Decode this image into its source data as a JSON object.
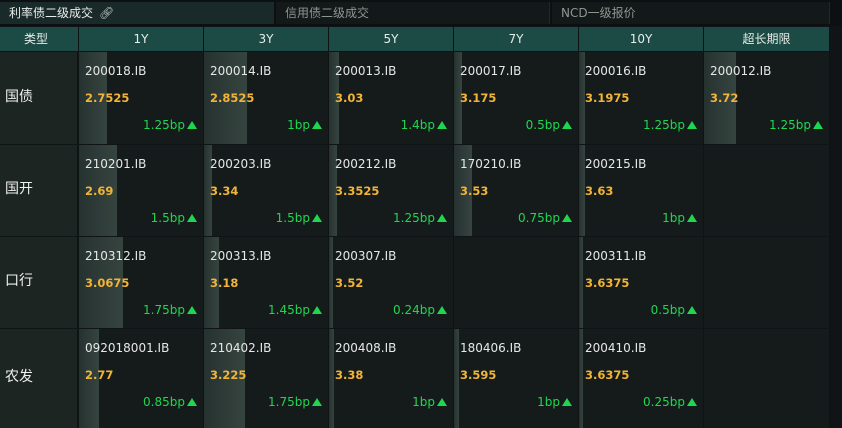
{
  "tabs": [
    {
      "label": "利率债二级成交",
      "active": true
    },
    {
      "label": "信用债二级成交",
      "active": false
    },
    {
      "label": "NCD一级报价",
      "active": false
    }
  ],
  "header": {
    "type_label": "类型",
    "columns": [
      "1Y",
      "3Y",
      "5Y",
      "7Y",
      "10Y",
      "超长期限"
    ]
  },
  "rows": [
    {
      "label": "国债",
      "cells": [
        {
          "code": "200018.IB",
          "price": "2.7525",
          "change": "1.25bp",
          "bar": 0.22
        },
        {
          "code": "200014.IB",
          "price": "2.8525",
          "change": "1bp",
          "bar": 0.34
        },
        {
          "code": "200013.IB",
          "price": "3.03",
          "change": "1.4bp",
          "bar": 0.08
        },
        {
          "code": "200017.IB",
          "price": "3.175",
          "change": "0.5bp",
          "bar": 0.06
        },
        {
          "code": "200016.IB",
          "price": "3.1975",
          "change": "1.25bp",
          "bar": 0.05
        },
        {
          "code": "200012.IB",
          "price": "3.72",
          "change": "1.25bp",
          "bar": 0.25
        }
      ]
    },
    {
      "label": "国开",
      "cells": [
        {
          "code": "210201.IB",
          "price": "2.69",
          "change": "1.5bp",
          "bar": 0.3
        },
        {
          "code": "200203.IB",
          "price": "3.34",
          "change": "1.5bp",
          "bar": 0.06
        },
        {
          "code": "200212.IB",
          "price": "3.3525",
          "change": "1.25bp",
          "bar": 0.06
        },
        {
          "code": "170210.IB",
          "price": "3.53",
          "change": "0.75bp",
          "bar": 0.14
        },
        {
          "code": "200215.IB",
          "price": "3.63",
          "change": "1bp",
          "bar": 0.05
        },
        null
      ]
    },
    {
      "label": "口行",
      "cells": [
        {
          "code": "210312.IB",
          "price": "3.0675",
          "change": "1.75bp",
          "bar": 0.35
        },
        {
          "code": "200313.IB",
          "price": "3.18",
          "change": "1.45bp",
          "bar": 0.12
        },
        {
          "code": "200307.IB",
          "price": "3.52",
          "change": "0.24bp",
          "bar": 0.03
        },
        null,
        {
          "code": "200311.IB",
          "price": "3.6375",
          "change": "0.5bp",
          "bar": 0.03
        },
        null
      ]
    },
    {
      "label": "农发",
      "cells": [
        {
          "code": "092018001.IB",
          "price": "2.77",
          "change": "0.85bp",
          "bar": 0.16
        },
        {
          "code": "210402.IB",
          "price": "3.225",
          "change": "1.75bp",
          "bar": 0.33
        },
        {
          "code": "200408.IB",
          "price": "3.38",
          "change": "1bp",
          "bar": 0.04
        },
        {
          "code": "180406.IB",
          "price": "3.595",
          "change": "1bp",
          "bar": 0.04
        },
        {
          "code": "200410.IB",
          "price": "3.6375",
          "change": "0.25bp",
          "bar": 0.03
        },
        null
      ]
    }
  ],
  "colors": {
    "header_bg": "#1c4a44",
    "price": "#f2b437",
    "change_up": "#1fd74f"
  }
}
